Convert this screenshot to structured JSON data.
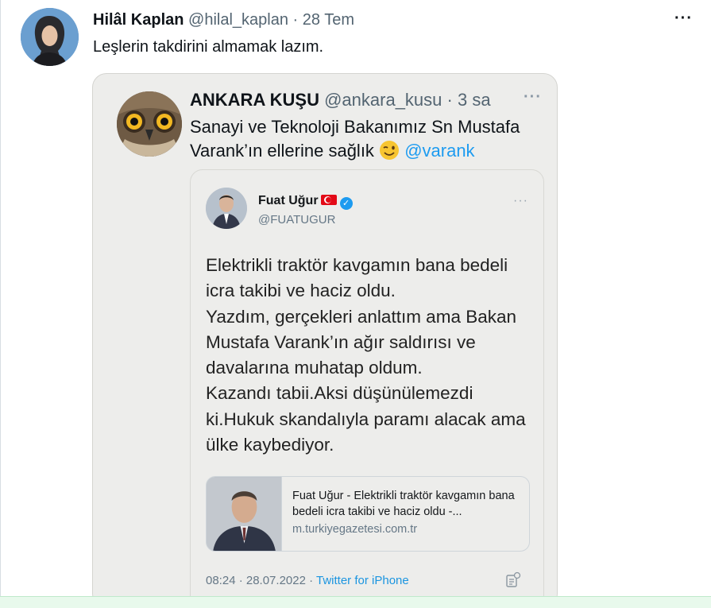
{
  "tweet": {
    "author_name": "Hilâl Kaplan",
    "author_handle": "@hilal_kaplan",
    "separator": " · ",
    "date": "28 Tem",
    "text": "Leşlerin takdirini almamak lazım.",
    "more_label": "···"
  },
  "quoted": {
    "author_name": "ANKARA KUŞU",
    "author_handle": "@ankara_kusu",
    "separator": " · ",
    "time": "3 sa",
    "more_label": "···",
    "text": "Sanayi ve Teknoloji Bakanımız Sn Mustafa Varank’ın ellerine sağlık",
    "mention": "@varank",
    "emoji": "winking-face-emoji"
  },
  "embedded": {
    "author_name": "Fuat Uğur",
    "author_handle": "@FUATUGUR",
    "verified_glyph": "✓",
    "more_label": "···",
    "text": "Elektrikli traktör kavgamın bana bedeli icra takibi ve haciz oldu.\nYazdım, gerçekleri anlattım ama Bakan Mustafa Varank’ın ağır saldırısı ve davalarına muhatap oldum.\nKazandı tabii.Aksi düşünülemezdi ki.Hukuk skandalıyla paramı alacak ama ülke kaybediyor.",
    "link_title": "Fuat Uğur - Elektrikli traktör kavgamın bana bedeli icra takibi ve haciz oldu -...",
    "link_domain": "m.turkiyegazetesi.com.tr",
    "timestamp": "08:24 · 28.07.2022 · ",
    "source_app": "Twitter for iPhone"
  },
  "colors": {
    "link_blue": "#1d9bf0",
    "muted_text": "#536471",
    "screenshot_bg": "#ededeb",
    "bottom_bar": "#e8f9ec"
  }
}
